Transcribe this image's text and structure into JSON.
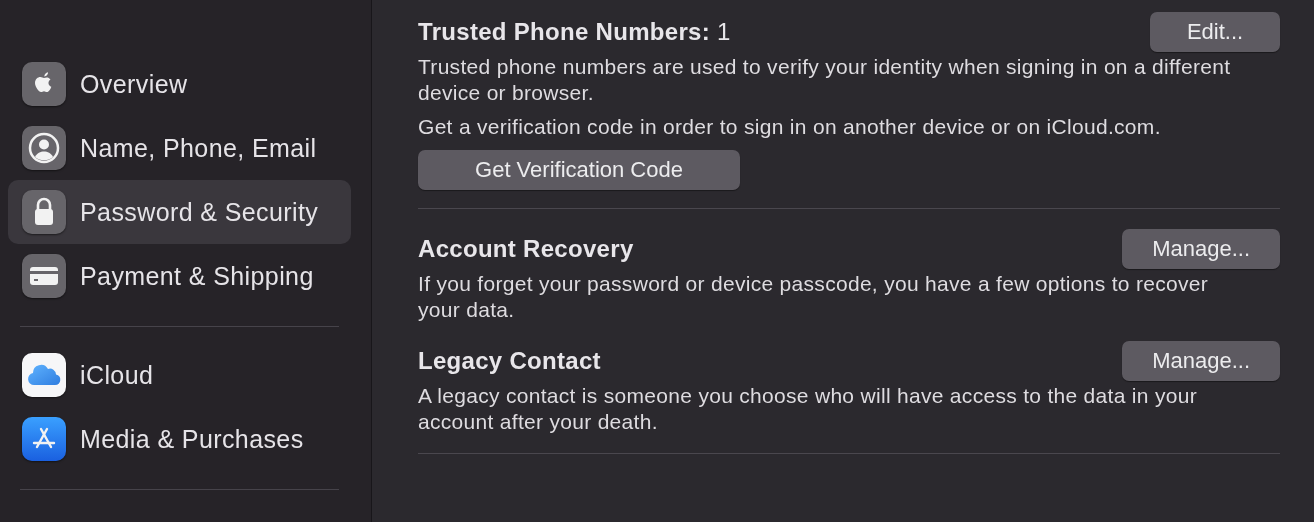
{
  "sidebar": {
    "groups": [
      {
        "items": [
          {
            "label": "Overview",
            "kind": "apple",
            "selected": false
          },
          {
            "label": "Name, Phone, Email",
            "kind": "person",
            "selected": false
          },
          {
            "label": "Password & Security",
            "kind": "lock",
            "selected": true
          },
          {
            "label": "Payment & Shipping",
            "kind": "card",
            "selected": false
          }
        ]
      },
      {
        "items": [
          {
            "label": "iCloud",
            "kind": "cloud",
            "selected": false
          },
          {
            "label": "Media & Purchases",
            "kind": "appstore",
            "selected": false
          }
        ]
      }
    ]
  },
  "content": {
    "groups": [
      {
        "sections": [
          {
            "title": "**Trusted Phone Numbers:** 1",
            "button": "Edit...",
            "paragraphs": [
              "Trusted phone numbers are used to verify your identity when signing in on a different device or browser.",
              "Get a verification code in order to sign in on another device or on iCloud.com."
            ],
            "action": "Get Verification Code"
          }
        ]
      },
      {
        "sections": [
          {
            "title": "Account Recovery",
            "button": "Manage...",
            "paragraphs": [
              "If you forget your password or device passcode, you have a few options to recover your data."
            ]
          },
          {
            "title": "Legacy Contact",
            "button": "Manage...",
            "paragraphs": [
              "A legacy contact is someone you choose who will have access to the data in your account after your death."
            ]
          }
        ]
      }
    ]
  }
}
